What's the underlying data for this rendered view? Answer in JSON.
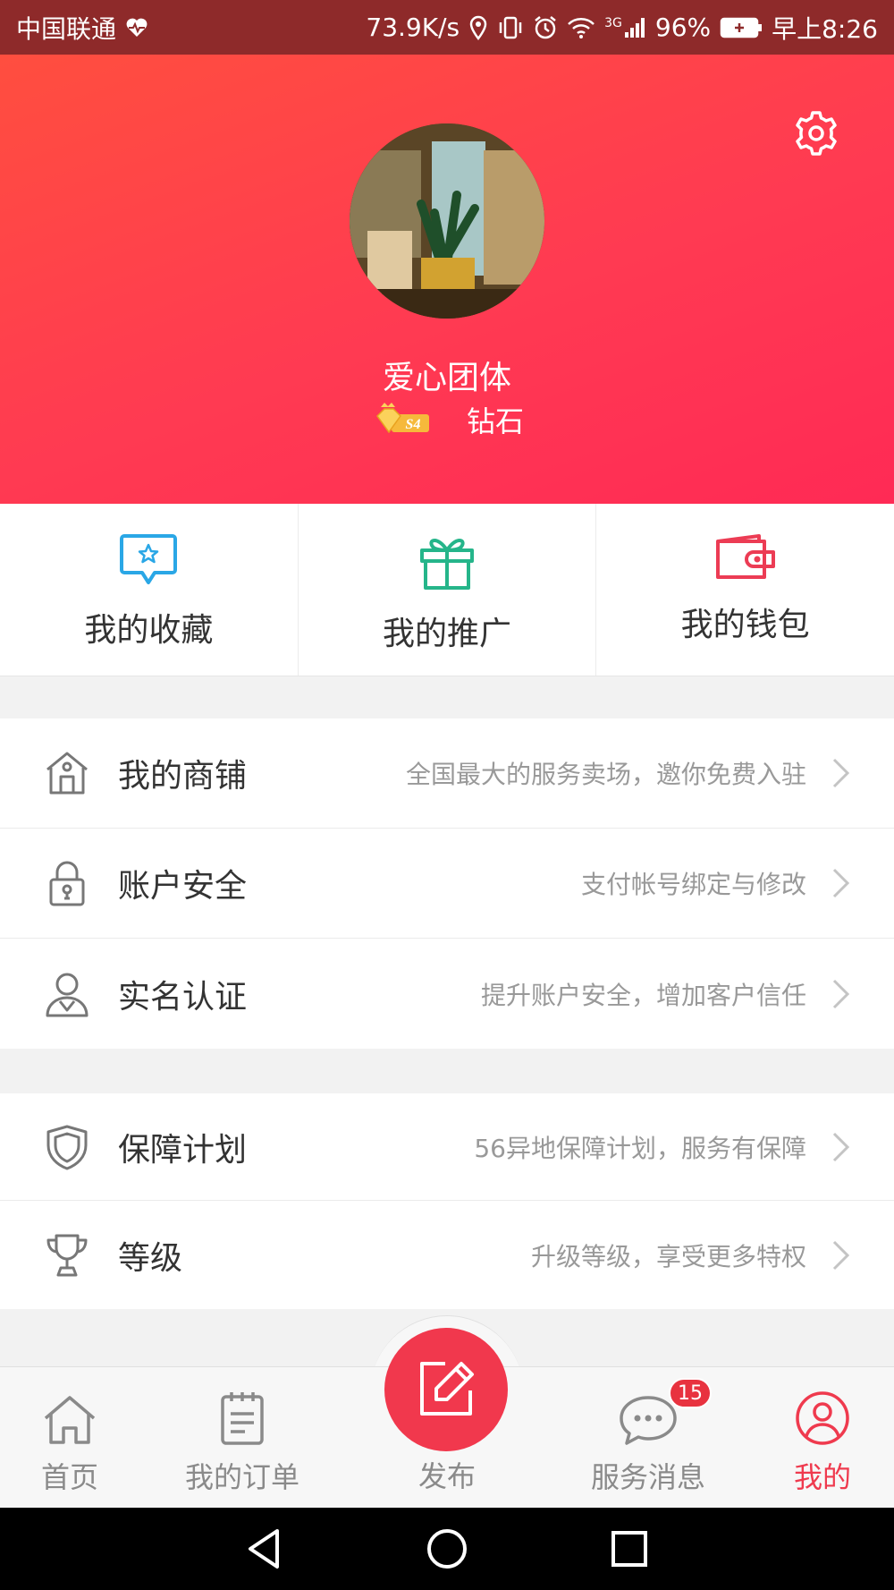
{
  "status_bar": {
    "carrier": "中国联通",
    "speed": "73.9K/s",
    "network": "3G",
    "battery": "96%",
    "time": "早上8:26"
  },
  "profile": {
    "name": "爱心团体",
    "level_code": "S4",
    "level_name": "钻石"
  },
  "quick_actions": [
    {
      "label": "我的收藏",
      "icon": "star-bubble-icon",
      "color": "#2aa7e6"
    },
    {
      "label": "我的推广",
      "icon": "gift-icon",
      "color": "#25b58a"
    },
    {
      "label": "我的钱包",
      "icon": "wallet-icon",
      "color": "#ec3c54"
    }
  ],
  "menu_group_1": [
    {
      "title": "我的商铺",
      "desc": "全国最大的服务卖场，邀你免费入驻",
      "icon": "store-icon"
    },
    {
      "title": "账户安全",
      "desc": "支付帐号绑定与修改",
      "icon": "lock-icon"
    },
    {
      "title": "实名认证",
      "desc": "提升账户安全，增加客户信任",
      "icon": "person-icon"
    }
  ],
  "menu_group_2": [
    {
      "title": "保障计划",
      "desc": "56异地保障计划，服务有保障",
      "icon": "shield-icon"
    },
    {
      "title": "等级",
      "desc": "升级等级，享受更多特权",
      "icon": "trophy-icon"
    }
  ],
  "tabbar": {
    "home": "首页",
    "orders": "我的订单",
    "publish": "发布",
    "messages": "服务消息",
    "messages_badge": "15",
    "mine": "我的",
    "active_color": "#ef3a4e",
    "inactive_color": "#8a8a8a"
  }
}
